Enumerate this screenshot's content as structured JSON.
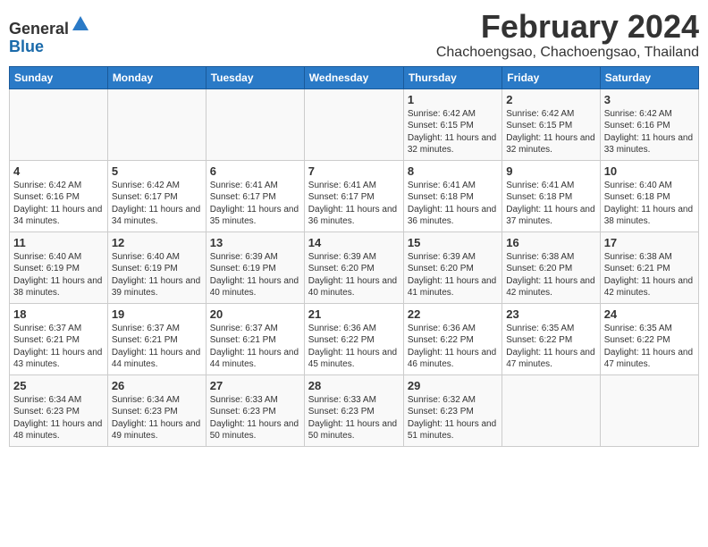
{
  "logo": {
    "general": "General",
    "blue": "Blue"
  },
  "title": "February 2024",
  "location": "Chachoengsao, Chachoengsao, Thailand",
  "weekdays": [
    "Sunday",
    "Monday",
    "Tuesday",
    "Wednesday",
    "Thursday",
    "Friday",
    "Saturday"
  ],
  "weeks": [
    [
      {
        "day": "",
        "info": ""
      },
      {
        "day": "",
        "info": ""
      },
      {
        "day": "",
        "info": ""
      },
      {
        "day": "",
        "info": ""
      },
      {
        "day": "1",
        "info": "Sunrise: 6:42 AM\nSunset: 6:15 PM\nDaylight: 11 hours and 32 minutes."
      },
      {
        "day": "2",
        "info": "Sunrise: 6:42 AM\nSunset: 6:15 PM\nDaylight: 11 hours and 32 minutes."
      },
      {
        "day": "3",
        "info": "Sunrise: 6:42 AM\nSunset: 6:16 PM\nDaylight: 11 hours and 33 minutes."
      }
    ],
    [
      {
        "day": "4",
        "info": "Sunrise: 6:42 AM\nSunset: 6:16 PM\nDaylight: 11 hours and 34 minutes."
      },
      {
        "day": "5",
        "info": "Sunrise: 6:42 AM\nSunset: 6:17 PM\nDaylight: 11 hours and 34 minutes."
      },
      {
        "day": "6",
        "info": "Sunrise: 6:41 AM\nSunset: 6:17 PM\nDaylight: 11 hours and 35 minutes."
      },
      {
        "day": "7",
        "info": "Sunrise: 6:41 AM\nSunset: 6:17 PM\nDaylight: 11 hours and 36 minutes."
      },
      {
        "day": "8",
        "info": "Sunrise: 6:41 AM\nSunset: 6:18 PM\nDaylight: 11 hours and 36 minutes."
      },
      {
        "day": "9",
        "info": "Sunrise: 6:41 AM\nSunset: 6:18 PM\nDaylight: 11 hours and 37 minutes."
      },
      {
        "day": "10",
        "info": "Sunrise: 6:40 AM\nSunset: 6:18 PM\nDaylight: 11 hours and 38 minutes."
      }
    ],
    [
      {
        "day": "11",
        "info": "Sunrise: 6:40 AM\nSunset: 6:19 PM\nDaylight: 11 hours and 38 minutes."
      },
      {
        "day": "12",
        "info": "Sunrise: 6:40 AM\nSunset: 6:19 PM\nDaylight: 11 hours and 39 minutes."
      },
      {
        "day": "13",
        "info": "Sunrise: 6:39 AM\nSunset: 6:19 PM\nDaylight: 11 hours and 40 minutes."
      },
      {
        "day": "14",
        "info": "Sunrise: 6:39 AM\nSunset: 6:20 PM\nDaylight: 11 hours and 40 minutes."
      },
      {
        "day": "15",
        "info": "Sunrise: 6:39 AM\nSunset: 6:20 PM\nDaylight: 11 hours and 41 minutes."
      },
      {
        "day": "16",
        "info": "Sunrise: 6:38 AM\nSunset: 6:20 PM\nDaylight: 11 hours and 42 minutes."
      },
      {
        "day": "17",
        "info": "Sunrise: 6:38 AM\nSunset: 6:21 PM\nDaylight: 11 hours and 42 minutes."
      }
    ],
    [
      {
        "day": "18",
        "info": "Sunrise: 6:37 AM\nSunset: 6:21 PM\nDaylight: 11 hours and 43 minutes."
      },
      {
        "day": "19",
        "info": "Sunrise: 6:37 AM\nSunset: 6:21 PM\nDaylight: 11 hours and 44 minutes."
      },
      {
        "day": "20",
        "info": "Sunrise: 6:37 AM\nSunset: 6:21 PM\nDaylight: 11 hours and 44 minutes."
      },
      {
        "day": "21",
        "info": "Sunrise: 6:36 AM\nSunset: 6:22 PM\nDaylight: 11 hours and 45 minutes."
      },
      {
        "day": "22",
        "info": "Sunrise: 6:36 AM\nSunset: 6:22 PM\nDaylight: 11 hours and 46 minutes."
      },
      {
        "day": "23",
        "info": "Sunrise: 6:35 AM\nSunset: 6:22 PM\nDaylight: 11 hours and 47 minutes."
      },
      {
        "day": "24",
        "info": "Sunrise: 6:35 AM\nSunset: 6:22 PM\nDaylight: 11 hours and 47 minutes."
      }
    ],
    [
      {
        "day": "25",
        "info": "Sunrise: 6:34 AM\nSunset: 6:23 PM\nDaylight: 11 hours and 48 minutes."
      },
      {
        "day": "26",
        "info": "Sunrise: 6:34 AM\nSunset: 6:23 PM\nDaylight: 11 hours and 49 minutes."
      },
      {
        "day": "27",
        "info": "Sunrise: 6:33 AM\nSunset: 6:23 PM\nDaylight: 11 hours and 50 minutes."
      },
      {
        "day": "28",
        "info": "Sunrise: 6:33 AM\nSunset: 6:23 PM\nDaylight: 11 hours and 50 minutes."
      },
      {
        "day": "29",
        "info": "Sunrise: 6:32 AM\nSunset: 6:23 PM\nDaylight: 11 hours and 51 minutes."
      },
      {
        "day": "",
        "info": ""
      },
      {
        "day": "",
        "info": ""
      }
    ]
  ]
}
